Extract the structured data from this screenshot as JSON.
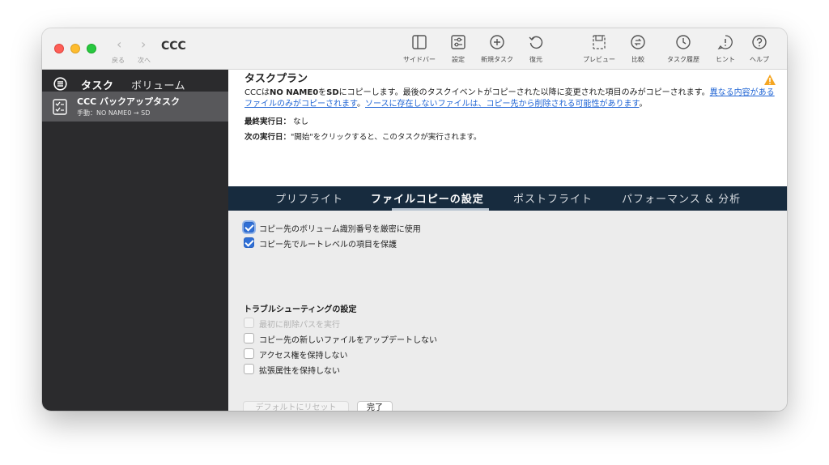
{
  "window": {
    "title": "CCC",
    "back_label": "戻る",
    "forward_label": "次へ",
    "toolbar": [
      {
        "icon": "sidebar-icon",
        "label": "サイドバー"
      },
      {
        "icon": "settings-icon",
        "label": "設定"
      },
      {
        "icon": "add-circle-icon",
        "label": "新規タスク"
      },
      {
        "icon": "restore-icon",
        "label": "復元"
      },
      {
        "icon": "preview-icon",
        "label": "プレビュー"
      },
      {
        "icon": "compare-icon",
        "label": "比較"
      },
      {
        "icon": "clock-icon",
        "label": "タスク履歴"
      },
      {
        "icon": "hint-icon",
        "label": "ヒント"
      },
      {
        "icon": "help-icon",
        "label": "ヘルプ"
      }
    ]
  },
  "sidebar": {
    "tabs": [
      "タスク",
      "ボリューム"
    ],
    "active_tab": "タスク",
    "task": {
      "title": "CCC バックアップタスク",
      "subtitle": "手動：NO NAME0 → SD"
    }
  },
  "plan": {
    "title": "タスクプラン",
    "desc_prefix": "CCCは",
    "desc_source": "NO NAME0",
    "desc_wo": "を",
    "desc_dest": "SD",
    "desc_main": "にコピーします。最後のタスクイベントがコピーされた以降に変更された項目のみがコピーされます。",
    "link1": "異なる内容があるファイルのみがコピーされます",
    "desc_sep": "。",
    "link2": "ソースに存在しないファイルは、コピー先から削除される可能性があります",
    "desc_end": "。",
    "last_run_label": "最終実行日：",
    "last_run_value": "なし",
    "next_run_label": "次の実行日：",
    "next_run_value": "\"開始\"をクリックすると、このタスクが実行されます。"
  },
  "tabs": [
    "プリフライト",
    "ファイルコピーの設定",
    "ポストフライト",
    "パフォーマンス & 分析"
  ],
  "active_tab": "ファイルコピーの設定",
  "settings": {
    "options": [
      {
        "label": "コピー先のボリューム識別番号を厳密に使用",
        "checked": true
      },
      {
        "label": "コピー先でルートレベルの項目を保護",
        "checked": true
      }
    ],
    "troubleshooting_title": "トラブルシューティングの設定",
    "troubleshooting": [
      {
        "label": "最初に削除パスを実行",
        "checked": false,
        "disabled": true
      },
      {
        "label": "コピー先の新しいファイルをアップデートしない",
        "checked": false
      },
      {
        "label": "アクセス権を保持しない",
        "checked": false
      },
      {
        "label": "拡張属性を保持しない",
        "checked": false
      }
    ],
    "reset_button": "デフォルトにリセット",
    "done_button": "完了"
  },
  "colors": {
    "sidebar_bg": "#2b2b2d",
    "sidebar_selected": "#58585b",
    "tabbar_bg": "#172b3e",
    "link": "#1f64d4",
    "checkbox": "#2f6fd6",
    "warning": "#f5a623"
  }
}
